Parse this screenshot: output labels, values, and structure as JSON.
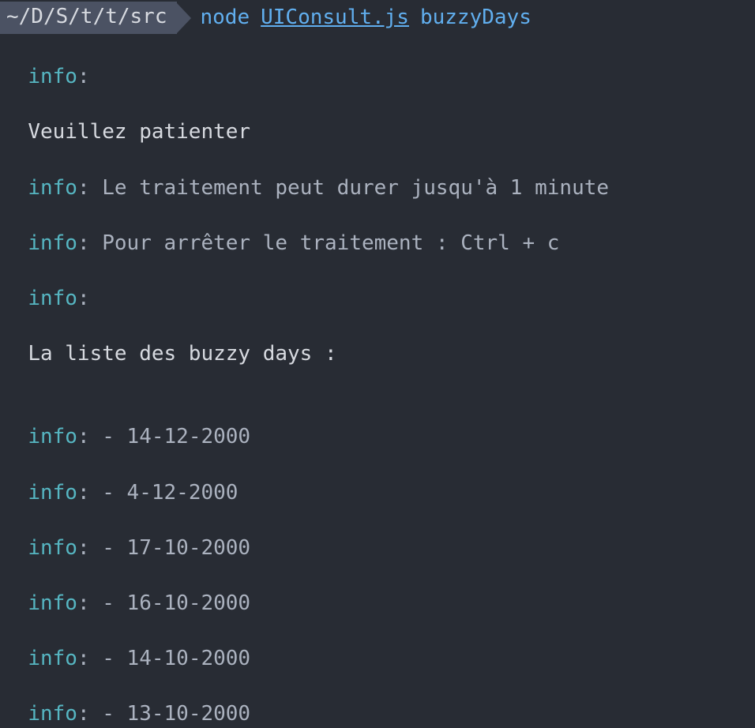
{
  "prompt": {
    "path": "~/D/S/t/t/src",
    "command": "node",
    "file": "UIConsult.js",
    "arg": "buzzyDays"
  },
  "output": {
    "info_label": "info",
    "colon": ":",
    "wait_msg": "Veuillez patienter",
    "line1": " Le traitement peut durer jusqu'à 1 minute",
    "line2": " Pour arrêter le traitement : Ctrl + c",
    "list_header": "La liste des buzzy days :",
    "dates": [
      " - 14-12-2000",
      " - 4-12-2000",
      " - 17-10-2000",
      " - 16-10-2000",
      " - 14-10-2000",
      " - 13-10-2000"
    ]
  }
}
